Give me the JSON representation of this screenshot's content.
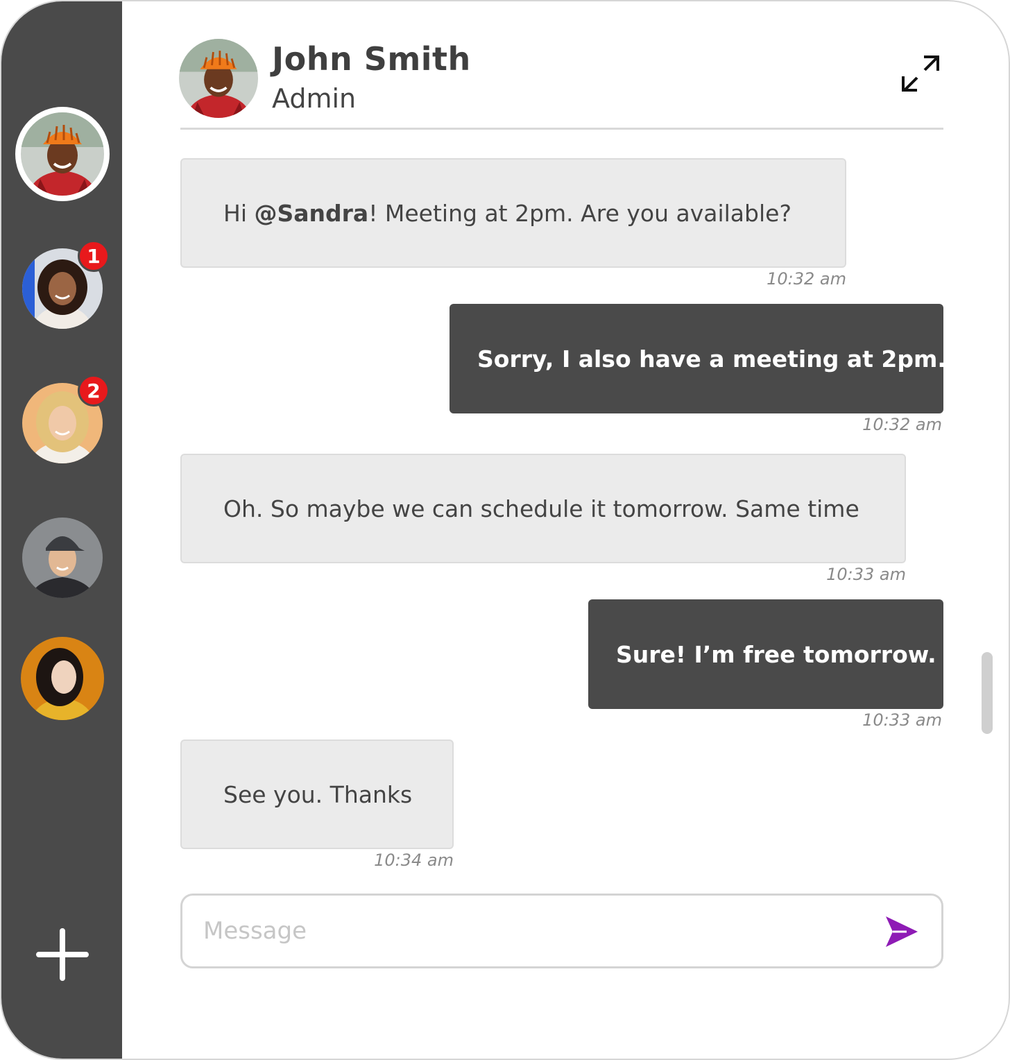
{
  "sidebar": {
    "contacts": [
      {
        "name": "john-smith",
        "badge": ""
      },
      {
        "name": "contact-2",
        "badge": "1"
      },
      {
        "name": "contact-3",
        "badge": "2"
      },
      {
        "name": "contact-4",
        "badge": ""
      },
      {
        "name": "contact-5",
        "badge": ""
      }
    ],
    "add_icon": "plus-icon"
  },
  "header": {
    "name": "John Smith",
    "role": "Admin",
    "expand_icon": "expand-icon"
  },
  "messages": [
    {
      "direction": "in",
      "prefix": "Hi ",
      "mention": "@Sandra",
      "text": "! Meeting at 2pm. Are you available?",
      "time": "10:32 am"
    },
    {
      "direction": "out",
      "text": "Sorry, I also have a meeting at 2pm.",
      "time": "10:32 am"
    },
    {
      "direction": "in",
      "text": "Oh. So maybe we can schedule it tomorrow. Same time",
      "time": "10:33 am"
    },
    {
      "direction": "out",
      "text": "Sure! I’m free tomorrow.",
      "time": "10:33 am"
    },
    {
      "direction": "in",
      "text": "See you. Thanks",
      "time": "10:34 am"
    }
  ],
  "composer": {
    "placeholder": "Message",
    "value": "",
    "send_icon": "send-icon"
  },
  "colors": {
    "sidebar": "#4a4a4a",
    "incoming_bubble": "#ebebeb",
    "outgoing_bubble": "#4a4a4a",
    "badge": "#e8191c",
    "send": "#8e1bb5"
  }
}
